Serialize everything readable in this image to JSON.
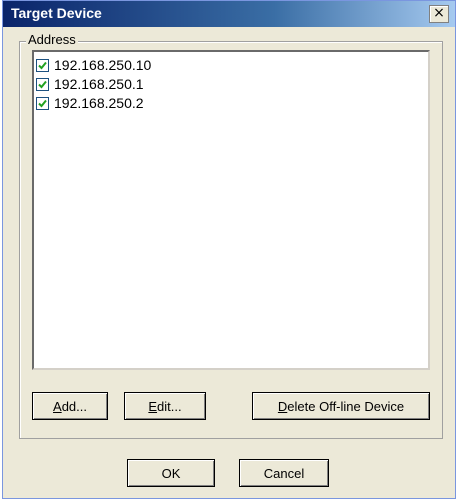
{
  "window": {
    "title": "Target Device",
    "close_glyph": "×"
  },
  "address_group": {
    "label": "Address",
    "items": [
      {
        "label": "192.168.250.10",
        "checked": true
      },
      {
        "label": "192.168.250.1",
        "checked": true
      },
      {
        "label": "192.168.250.2",
        "checked": true
      }
    ]
  },
  "buttons": {
    "add": {
      "mnemonic": "A",
      "rest": "dd..."
    },
    "edit": {
      "mnemonic": "E",
      "rest": "dit..."
    },
    "delete": {
      "mnemonic": "D",
      "rest": "elete Off-line Device"
    },
    "ok": "OK",
    "cancel": "Cancel"
  },
  "colors": {
    "checkmark": "#21a121",
    "title_gradient_start": "#0a246a"
  }
}
